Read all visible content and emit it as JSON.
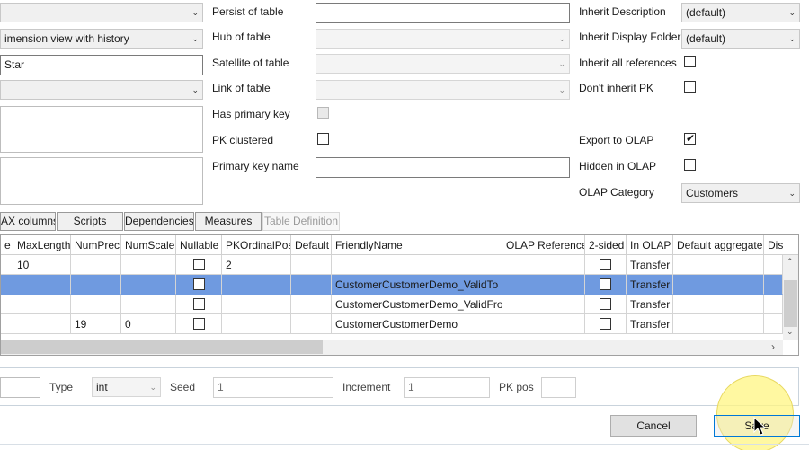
{
  "left_panel": {
    "combo1_value": "",
    "view_type_value": "imension view with history",
    "name_value": "Star",
    "combo4_value": ""
  },
  "table_links": {
    "persist_label": "Persist of table",
    "hub_label": "Hub of table",
    "satellite_label": "Satellite of table",
    "link_label": "Link of table",
    "has_pk_label": "Has primary key",
    "pk_clustered_label": "PK clustered",
    "pk_name_label": "Primary key name",
    "persist_value": "",
    "hub_value": "",
    "satellite_value": "",
    "link_value": "",
    "pk_name_value": "",
    "has_pk_checked": false,
    "pk_clustered_checked": false
  },
  "olap": {
    "inherit_description_label": "Inherit Description",
    "inherit_description_value": "(default)",
    "inherit_display_folder_label": "Inherit Display Folder",
    "inherit_display_folder_value": "(default)",
    "inherit_all_refs_label": "Inherit all references",
    "dont_inherit_pk_label": "Don't inherit PK",
    "export_olap_label": "Export to OLAP",
    "hidden_olap_label": "Hidden in OLAP",
    "olap_category_label": "OLAP Category",
    "olap_category_value": "Customers",
    "inherit_all_refs_checked": false,
    "dont_inherit_pk_checked": false,
    "export_olap_checked": true,
    "hidden_olap_checked": false
  },
  "tabs": [
    {
      "label": "AX columns"
    },
    {
      "label": "Scripts"
    },
    {
      "label": "Dependencies"
    },
    {
      "label": "Measures"
    },
    {
      "label": "Table Definition"
    }
  ],
  "grid": {
    "headers": [
      "e",
      "MaxLength",
      "NumPrec",
      "NumScale",
      "Nullable",
      "PKOrdinalPos",
      "Default",
      "FriendlyName",
      "OLAP Reference",
      "2-sided",
      "In OLAP",
      "Default aggregate",
      "Dis"
    ],
    "rows": [
      {
        "maxlength": "10",
        "numprec": "",
        "numscale": "",
        "nullable": false,
        "pkpos": "2",
        "default": "",
        "friendly": "",
        "olapref": "",
        "twosided": false,
        "inolap": "Transfer",
        "defagg": "",
        "selected": false
      },
      {
        "maxlength": "",
        "numprec": "",
        "numscale": "",
        "nullable": false,
        "pkpos": "",
        "default": "",
        "friendly": "CustomerCustomerDemo_ValidTo",
        "olapref": "",
        "twosided": false,
        "inolap": "Transfer",
        "defagg": "",
        "selected": true
      },
      {
        "maxlength": "",
        "numprec": "",
        "numscale": "",
        "nullable": false,
        "pkpos": "",
        "default": "",
        "friendly": "CustomerCustomerDemo_ValidFrom",
        "olapref": "",
        "twosided": false,
        "inolap": "Transfer",
        "defagg": "",
        "selected": false
      },
      {
        "maxlength": "",
        "numprec": "19",
        "numscale": "0",
        "nullable": false,
        "pkpos": "",
        "default": "",
        "friendly": "CustomerCustomerDemo",
        "olapref": "",
        "twosided": false,
        "inolap": "Transfer",
        "defagg": "",
        "selected": false
      }
    ]
  },
  "identity": {
    "type_label": "Type",
    "type_value": "int",
    "seed_label": "Seed",
    "seed_value": "1",
    "increment_label": "Increment",
    "increment_value": "1",
    "pkpos_label": "PK pos",
    "pkpos_value": ""
  },
  "footer": {
    "cancel_label": "Cancel",
    "save_label": "Save"
  },
  "icons": {
    "dropdown": "chevron-down-icon",
    "scroll_up": "chevron-up-icon",
    "scroll_down": "chevron-down-icon",
    "scroll_right": "chevron-right-icon",
    "cursor": "mouse-pointer-icon"
  },
  "colors": {
    "selection": "#6f9ae0",
    "highlight": "#fff59a",
    "primary_border": "#0078d7"
  }
}
